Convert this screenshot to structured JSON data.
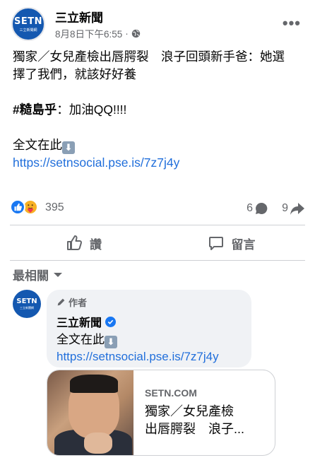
{
  "post": {
    "page_name": "三立新聞",
    "logo_main": "SETN",
    "logo_sub": "三立新聞網",
    "date": "8月8日下午6:55",
    "separator": "·",
    "text_line1": "獨家／女兒產檢出唇腭裂　浪子回頭新手爸：她選擇了我們，就該好好養",
    "hashtag": "#糙島乎",
    "hashtag_rest": "：加油QQ!!!!",
    "full_text_label": "全文在此",
    "link": "https://setnsocial.pse.is/7z7j4y",
    "more_label": "•••"
  },
  "reactions": {
    "count": "395",
    "comments": "6",
    "shares": "9"
  },
  "actions": {
    "like_label": "讚",
    "comment_label": "留言"
  },
  "comments": {
    "sort_label": "最相關",
    "author_badge": "作者",
    "commenter_name": "三立新聞",
    "logo_main": "SETN",
    "logo_sub": "三立新聞網",
    "body": "全文在此",
    "link": "https://setnsocial.pse.is/7z7j4y",
    "preview_domain": "SETN.COM",
    "preview_title_line1": "獨家／女兒產檢",
    "preview_title_line2": "出唇腭裂　浪子..."
  },
  "colors": {
    "brand_blue": "#1458b0",
    "link_blue": "#216fdb",
    "like_blue": "#1877f2",
    "meta_gray": "#65676b"
  },
  "icons": [
    "globe-icon",
    "more-icon",
    "down-arrow-emoji",
    "like-reaction-icon",
    "care-reaction-icon",
    "comment-bubble-icon",
    "share-arrow-icon",
    "thumbs-up-icon",
    "comment-icon",
    "dropdown-caret-icon",
    "pencil-icon",
    "verified-icon"
  ]
}
